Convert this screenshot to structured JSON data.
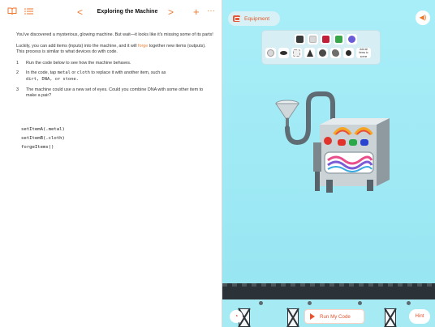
{
  "toolbar": {
    "book_icon": "book-icon",
    "list_icon": "list-icon",
    "prev_glyph": "<",
    "title": "Exploring the Machine",
    "next_glyph": ">",
    "add_glyph": "+",
    "more_glyph": "···",
    "accent_color": "#f0762b"
  },
  "instructions": {
    "intro": "You've discovered a mysterious, glowing machine. But wait—it looks like it's missing some of its parts!",
    "para_before": "Luckily, you can add items (inputs) into the machine, and it will ",
    "para_link": "forge",
    "para_after": " together new items (outputs). This process is similar to what devices do with code.",
    "steps": [
      {
        "num": "1",
        "text": "Run the code below to see how the machine behaves."
      },
      {
        "num": "2",
        "pre": "In the code, tap ",
        "code1": "metal",
        "mid": " or ",
        "code2": "cloth",
        "post": " to replace it with another item, such as ",
        "tail": "dirt, DNA, or stone."
      },
      {
        "num": "3",
        "text": "The machine could use a new set of eyes. Could you combine DNA with some other item to make a pair?"
      }
    ]
  },
  "code_lines": [
    "setItemA(.metal)",
    "setItemB(.cloth)",
    "forgeItems()"
  ],
  "scene": {
    "equipment_label": "Equipment",
    "sound_glyph": "◀)",
    "inventory": {
      "row1": [
        "dark-cube",
        "white-cube",
        "red-cube",
        "green-cube",
        "purple-sphere"
      ],
      "row2": [
        "swirl-item",
        "dna-item",
        "fur-item",
        "pyramid-item",
        "stone-item",
        "rock-item",
        "leaf-item",
        "gear-item"
      ],
      "more_label": "Add all items to scene"
    },
    "run_label": "Run My Code",
    "hint_label": "Hint",
    "speed_glyph": "◔",
    "colors": {
      "sky": "#a8eef8",
      "floor": "#2c3338",
      "button_text": "#e8532e"
    }
  }
}
